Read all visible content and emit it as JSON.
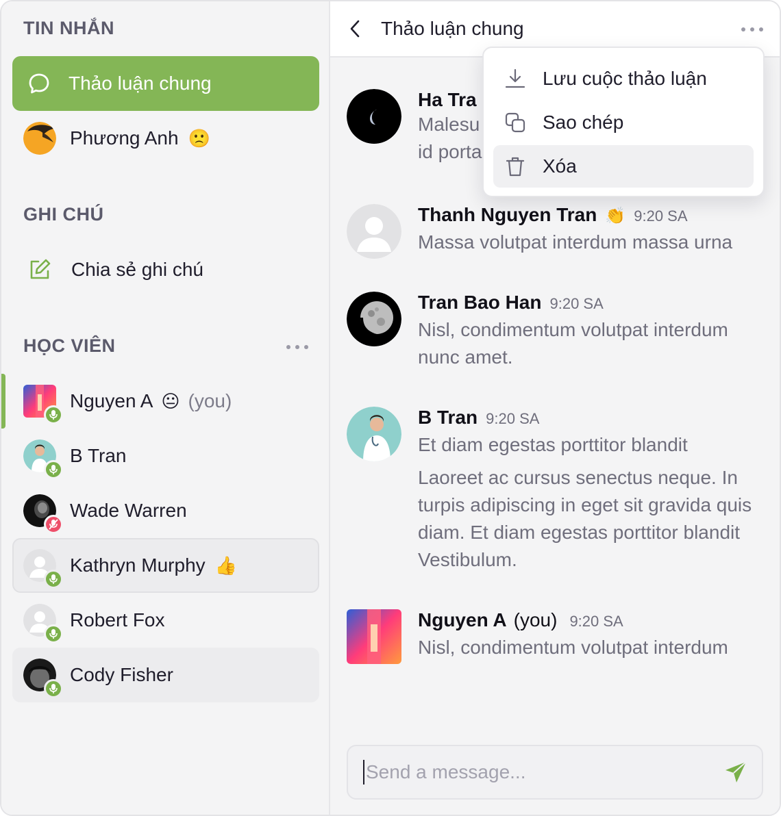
{
  "sidebar": {
    "messages_title": "TIN NHẮN",
    "messages": [
      {
        "label": "Thảo luận chung",
        "active": true
      },
      {
        "label": "Phương Anh",
        "emoji": "🙁"
      }
    ],
    "notes_title": "GHI CHÚ",
    "notes": [
      {
        "label": "Chia sẻ ghi chú"
      }
    ],
    "students_title": "HỌC VIÊN",
    "students": [
      {
        "name": "Nguyen A",
        "emoji": "😐",
        "you_tag": "(you)",
        "mic": "on"
      },
      {
        "name": "B Tran",
        "mic": "on"
      },
      {
        "name": "Wade Warren",
        "mic": "off"
      },
      {
        "name": "Kathryn Murphy",
        "emoji": "👍",
        "mic": "on"
      },
      {
        "name": "Robert Fox",
        "mic": "on"
      },
      {
        "name": "Cody Fisher",
        "mic": "on"
      }
    ]
  },
  "header": {
    "title": "Thảo luận chung"
  },
  "menu": {
    "items": [
      {
        "label": "Lưu cuộc thảo luận",
        "icon": "download-icon"
      },
      {
        "label": "Sao chép",
        "icon": "copy-icon"
      },
      {
        "label": "Xóa",
        "icon": "trash-icon"
      }
    ]
  },
  "messages": [
    {
      "name": "Ha Tra",
      "text_line1": "Malesu",
      "text_line2": "id porta"
    },
    {
      "name": "Thanh Nguyen Tran",
      "emoji": "👏",
      "time": "9:20 SA",
      "text": "Massa volutpat interdum massa urna"
    },
    {
      "name": "Tran Bao Han",
      "time": "9:20 SA",
      "text": "Nisl, condimentum volutpat interdum nunc amet."
    },
    {
      "name": "B Tran",
      "time": "9:20 SA",
      "text": "Et diam egestas porttitor blandit",
      "text2": "Laoreet ac cursus senectus neque. In turpis adipiscing in eget sit gravida quis diam. Et diam egestas porttitor blandit Vestibulum."
    },
    {
      "name": "Nguyen A",
      "you_tag": "(you)",
      "time": "9:20 SA",
      "text": "Nisl, condimentum volutpat interdum"
    }
  ],
  "composer": {
    "placeholder": "Send a message..."
  },
  "colors": {
    "accent": "#84b656",
    "mic_on": "#7ab04a",
    "mic_off": "#ee4f6a",
    "muted_text": "#6f6e7c"
  }
}
